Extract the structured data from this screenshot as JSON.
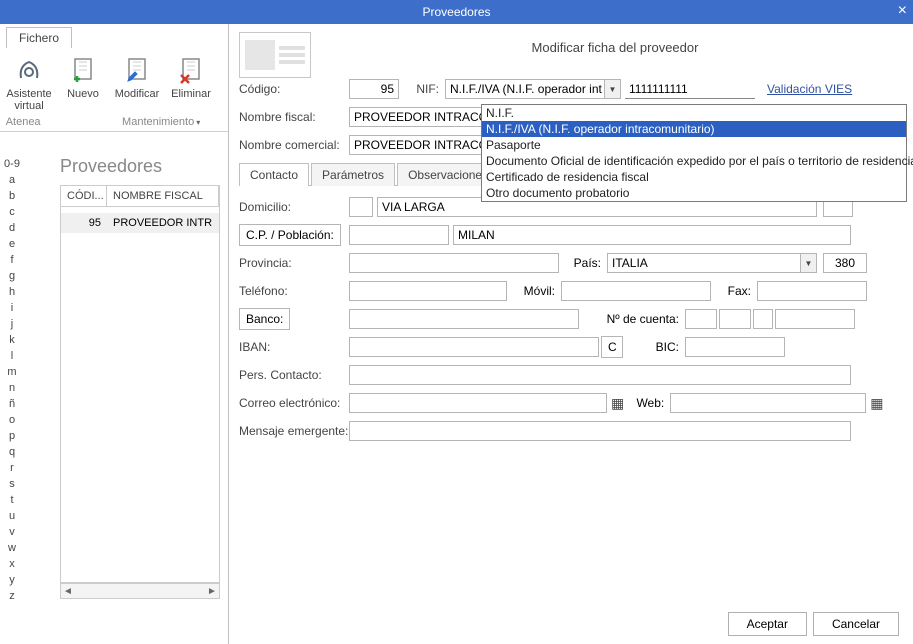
{
  "titlebar": {
    "title": "Proveedores"
  },
  "ribbon": {
    "file_tab": "Fichero",
    "asistente": "Asistente\nvirtual",
    "nuevo": "Nuevo",
    "modificar": "Modificar",
    "eliminar": "Eliminar",
    "group_atenea": "Atenea",
    "group_mantenimiento": "Mantenimiento"
  },
  "alpha": [
    "0-9",
    "a",
    "b",
    "c",
    "d",
    "e",
    "f",
    "g",
    "h",
    "i",
    "j",
    "k",
    "l",
    "m",
    "n",
    "ñ",
    "o",
    "p",
    "q",
    "r",
    "s",
    "t",
    "u",
    "v",
    "w",
    "x",
    "y",
    "z"
  ],
  "list": {
    "title": "Proveedores",
    "col_codigo": "CÓDI...",
    "col_nombre": "NOMBRE FISCAL",
    "row_codigo": "95",
    "row_nombre": "PROVEEDOR INTR"
  },
  "modal": {
    "title": "Modificar ficha del proveedor",
    "lbl_codigo": "Código:",
    "codigo": "95",
    "lbl_nif": "NIF:",
    "nif_type": "N.I.F./IVA (N.I.F. operador int",
    "nif_value": "1111111111",
    "link_vies": "Validación VIES",
    "lbl_nombre_fiscal": "Nombre fiscal:",
    "nombre_fiscal": "PROVEEDOR INTRACOM",
    "lbl_nombre_comercial": "Nombre comercial:",
    "nombre_comercial": "PROVEEDOR INTRACOM",
    "tabs": {
      "contacto": "Contacto",
      "parametros": "Parámetros",
      "observaciones": "Observaciones"
    },
    "lbl_domicilio": "Domicilio:",
    "domicilio": "VIA LARGA",
    "btn_cp": "C.P. / Población:",
    "poblacion": "MILAN",
    "lbl_provincia": "Provincia:",
    "lbl_pais": "País:",
    "pais": "ITALIA",
    "pais_code": "380",
    "lbl_telefono": "Teléfono:",
    "lbl_movil": "Móvil:",
    "lbl_fax": "Fax:",
    "btn_banco": "Banco:",
    "lbl_cuenta": "Nº de cuenta:",
    "lbl_iban": "IBAN:",
    "btn_c": "C",
    "lbl_bic": "BIC:",
    "lbl_pers": "Pers. Contacto:",
    "lbl_correo": "Correo electrónico:",
    "lbl_web": "Web:",
    "lbl_mensaje": "Mensaje emergente:",
    "dropdown": {
      "opt0": "N.I.F.",
      "opt1": "N.I.F./IVA (N.I.F. operador intracomunitario)",
      "opt2": "Pasaporte",
      "opt3": "Documento Oficial de identificación expedido por el país o territorio de residencia",
      "opt4": "Certificado de residencia fiscal",
      "opt5": "Otro documento probatorio"
    },
    "btn_aceptar": "Aceptar",
    "btn_cancelar": "Cancelar"
  }
}
